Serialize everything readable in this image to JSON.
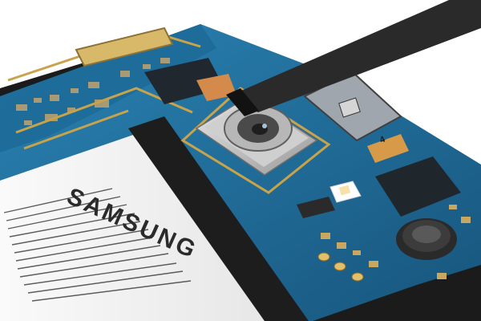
{
  "scene": {
    "subject": "smartphone-logic-board-teardown",
    "battery": {
      "brand": "SAMSUNG"
    },
    "chip_marking": "4",
    "colors": {
      "background": "#ffffff",
      "pcb": "#1f6f9e",
      "pcb_dark": "#154f73",
      "gold": "#c9a34a",
      "frame": "#1a1a1a",
      "battery": "#f2f2f2",
      "camera_metal": "#b9b9b9",
      "spudger": "#2a2a2a"
    },
    "icons": [
      "camera-module",
      "flash-led",
      "vibration-motor",
      "spudger-tool"
    ]
  }
}
